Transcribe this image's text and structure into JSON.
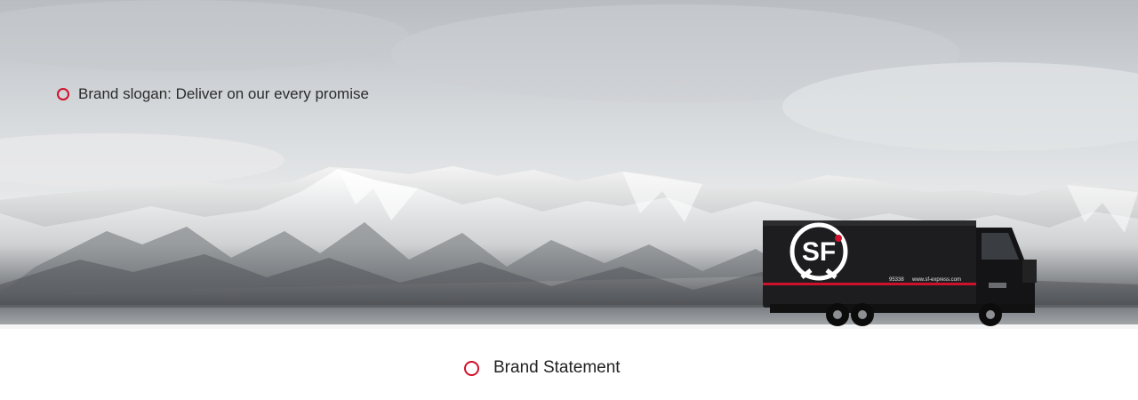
{
  "banner": {
    "slogan_text": "Brand slogan: Deliver on our every promise",
    "slogan_icon": "circle-outline-icon",
    "accent_color": "#d0112b",
    "truck": {
      "logo_text": "SF",
      "phone": "95338",
      "url": "www.sf-express.com"
    }
  },
  "section": {
    "statement_label": "Brand Statement",
    "statement_icon": "circle-outline-icon"
  }
}
